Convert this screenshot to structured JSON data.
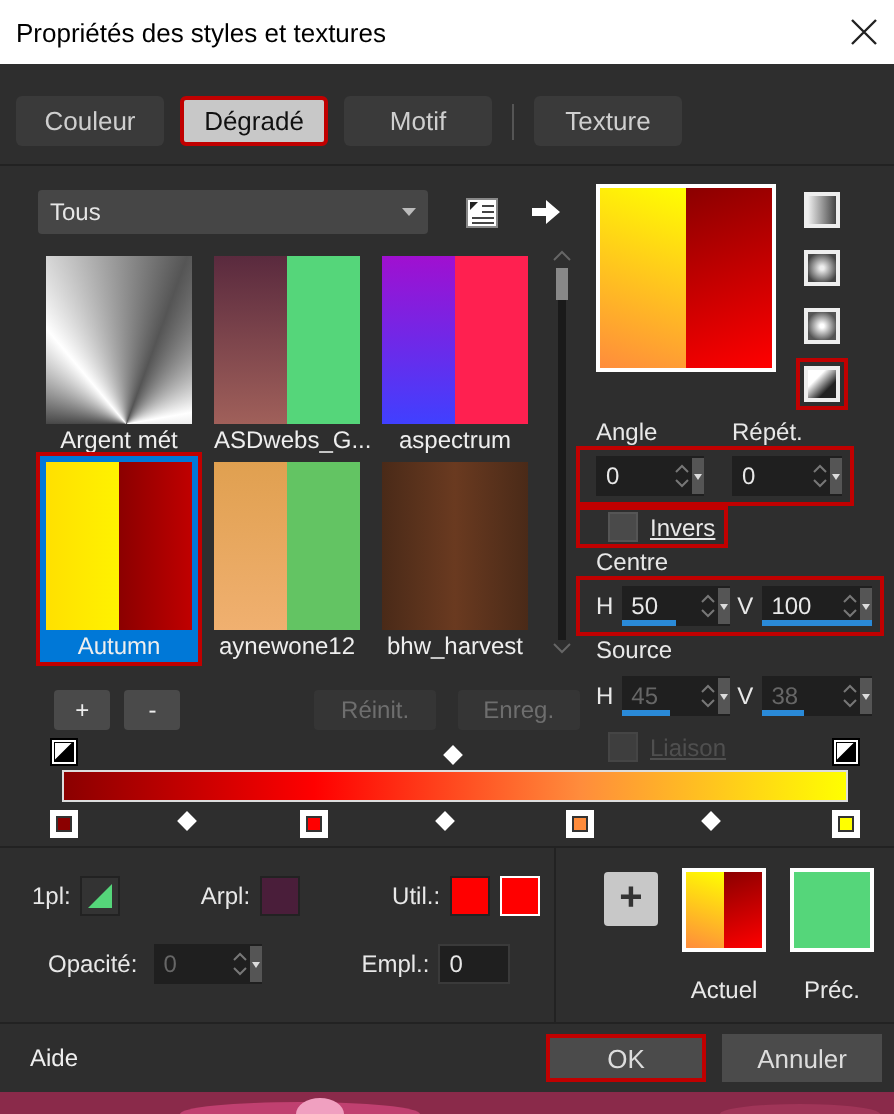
{
  "window": {
    "title": "Propriétés des styles et textures"
  },
  "tabs": [
    {
      "label": "Couleur",
      "selected": false,
      "highlighted": false
    },
    {
      "label": "Dégradé",
      "selected": true,
      "highlighted": true
    },
    {
      "label": "Motif",
      "selected": false,
      "highlighted": false
    },
    {
      "label": "Texture",
      "selected": false,
      "highlighted": false
    }
  ],
  "library": {
    "category": "Tous",
    "items": [
      {
        "label": "Argent mét",
        "kind": "metal",
        "selected": false,
        "highlighted": false
      },
      {
        "label": "ASDwebs_G...",
        "kind": "plumgreen",
        "selected": false,
        "highlighted": false
      },
      {
        "label": "aspectrum",
        "kind": "spectrum",
        "selected": false,
        "highlighted": false
      },
      {
        "label": "Autumn",
        "kind": "autumn",
        "selected": true,
        "highlighted": true
      },
      {
        "label": "aynewone12",
        "kind": "checker",
        "selected": false,
        "highlighted": false
      },
      {
        "label": "bhw_harvest",
        "kind": "harvest",
        "selected": false,
        "highlighted": false
      }
    ],
    "buttons": [
      {
        "label": "+",
        "disabled": false
      },
      {
        "label": "-",
        "disabled": false
      },
      {
        "label": "Réinit.",
        "disabled": true
      },
      {
        "label": "Enreg.",
        "disabled": true
      }
    ]
  },
  "style_buttons": [
    {
      "kind": "linear",
      "highlighted": false
    },
    {
      "kind": "rectangular",
      "highlighted": false
    },
    {
      "kind": "radial",
      "highlighted": false
    },
    {
      "kind": "corner",
      "highlighted": true
    }
  ],
  "angle": {
    "label": "Angle",
    "value": "0"
  },
  "repeat": {
    "label": "Répét.",
    "value": "0"
  },
  "params_highlighted": true,
  "invert": {
    "label": "Invers",
    "checked": false,
    "highlighted": true
  },
  "centre": {
    "label": "Centre",
    "highlighted": true,
    "h": {
      "label": "H",
      "value": "50",
      "level": 0.5
    },
    "v": {
      "label": "V",
      "value": "100",
      "level": 1
    }
  },
  "source": {
    "label": "Source",
    "disabled": true,
    "h": {
      "label": "H",
      "value": "45",
      "level": 0.45
    },
    "v": {
      "label": "V",
      "value": "38",
      "level": 0.38
    }
  },
  "link": {
    "label": "Liaison",
    "checked": false,
    "disabled": true
  },
  "gradient_editor": {
    "opacity_stops": [
      {
        "level": 0
      },
      {
        "level": 1
      }
    ],
    "color_stops": [
      {
        "level": 0,
        "color": "#8b0000"
      },
      {
        "level": 0.32,
        "color": "#ff0000"
      },
      {
        "level": 0.66,
        "color": "#ff8c3c"
      },
      {
        "level": 1,
        "color": "#ffff00"
      }
    ]
  },
  "swatches": [
    {
      "label": "1pl:",
      "kind": "gradient",
      "color": "#55d67a"
    },
    {
      "label": "Arpl:",
      "kind": "solid",
      "color": "#4a1e3a"
    },
    {
      "label": "Util.:",
      "kind": "pair",
      "color": "#ff0000"
    }
  ],
  "opacity": {
    "label": "Opacité:",
    "value": "0",
    "disabled": true
  },
  "location": {
    "label": "Empl.:",
    "value": "0"
  },
  "add_button": {
    "label": "+"
  },
  "current": {
    "label": "Actuel"
  },
  "previous": {
    "label": "Préc.",
    "color": "#55d67a"
  },
  "footer": {
    "help": "Aide",
    "buttons": [
      {
        "label": "OK",
        "highlighted": true
      },
      {
        "label": "Annuler",
        "highlighted": false
      }
    ]
  }
}
